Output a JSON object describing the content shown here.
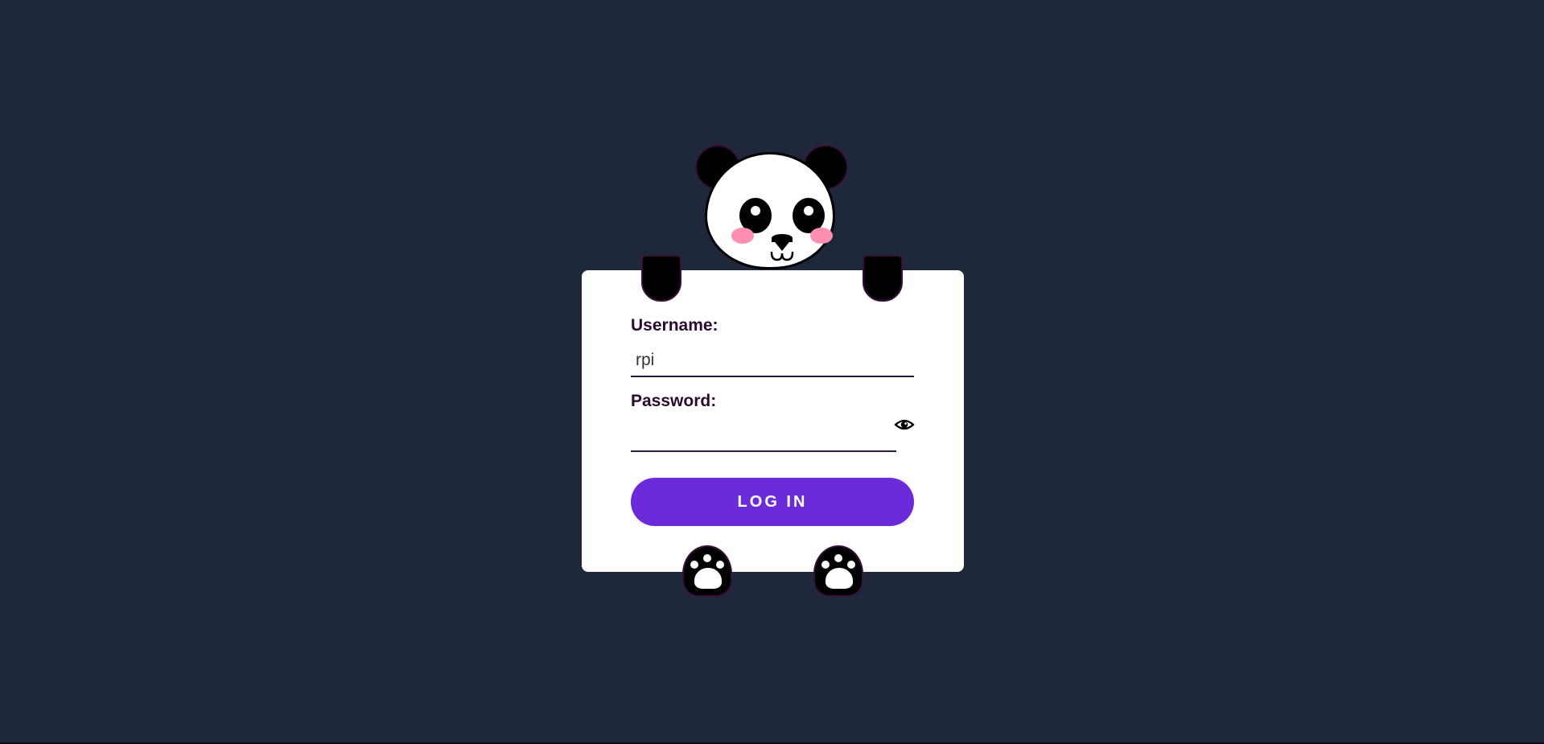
{
  "login_form": {
    "username_label": "Username:",
    "username_value": "rpi",
    "password_label": "Password:",
    "password_value": "",
    "login_button_label": "LOG IN"
  },
  "icons": {
    "password_toggle": "eye-icon"
  },
  "colors": {
    "background": "#1f283b",
    "card": "#ffffff",
    "button": "#6c2bd9",
    "cheek": "#ff8fb0"
  }
}
